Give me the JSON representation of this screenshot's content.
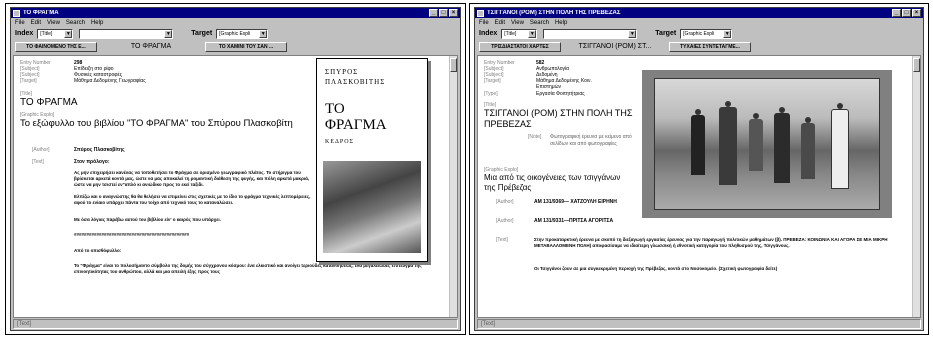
{
  "left": {
    "title": "ΤΟ ΦΡΑΓΜΑ",
    "menu": [
      "File",
      "Edit",
      "View",
      "Search",
      "Help"
    ],
    "index_label": "Index",
    "index_value": "[Title]",
    "term_value": "",
    "target_label": "Target",
    "target_value": "[Graphic Expli",
    "nav_prev": "ΤΟ ΦΑΙΝΟΜΕΝΟ ΤΗΣ Ε...",
    "nav_current": "ΤΟ ΦΡΑΓΜΑ",
    "nav_next": "ΤΟ ΧΑΜΙΝΙ ΤΟΥ ΣΑΝ ...",
    "entry_number_label": "Entry Number",
    "entry_number": "298",
    "subject1_label": "[Subject]",
    "subject1": "Επίδειξη στο ρίφο",
    "subject2_label": "[Subject]",
    "subject2": "Φυσικές καταστροφές",
    "target_field_label": "[Target]",
    "target_field": "Μάθημα Δεδομένης Γεωγραφίας",
    "title_label": "[Title]",
    "graphic_label": "[Graphic Explo]",
    "graphic_text": "Το εξώφυλλο του βιβλίου \"ΤΟ ΦΡΑΓΜΑ\" του Σπύρου Πλασκοβίτη",
    "author_label": "[Author]",
    "author": "Σπύρος Πλασκοβίτης",
    "text_label": "[Text]",
    "text_intro": "Στον πρόλογο:",
    "text_p1": "Ας μην επιχειρήσει κανένας να τοποθετήσει το Φράγμα σε ορισμένο γεωγραφικό πλάτος. Το στήριγμα του βρίσκεται αρκετά κοντά μας, ώστε να μας αποκαλεί τη ρομαντική διάθεση της φυγής, και πόλη αρκετά μακριά, ώστε να μην τσιστεί εν\"απλό κι ανιώδικο προς το εκεί ταξίδι.",
    "text_p2": "Ελπίζω και ο αναγνώστης θα θα θελήσει να επιμείνει στις σχετικές με το ίδιο το φράγμα τεχνικές λεπτομέρειες, αφού το ενίαιο υπάρχει πάντα του τοίχο από τεχνικό τους το καταναλώσει.",
    "text_p3": "Με όσα λόγιας παρέβω αυτού του βιβλίου είν' ο καιρός που υπάρχει.",
    "text_sep": "##############################################",
    "text_p4": "Από το οπισθόφυλλο:",
    "text_p5": "Το \"Φράγμα\" είναι το πολυσήμαντο σύμβολο της δομής του σύγχρονου κόσμου: ένα ελκιστικό και ανοίγει τεριούδες κατανοήσεως, ένα μεγαλειώδες επίτευγμα της επινοητικότητας του ανθρώπου, αλλά και μια απειλή έξης προς τους",
    "book_author": "ΣΠΥΡΟΣ ΠΛΑΣΚΟΒΙΤΗΣ",
    "book_title_1": "ΤΟ",
    "book_title_2": "ΦΡΑΓΜΑ",
    "book_publisher": "ΚΕΔΡΟΣ",
    "status": "[Text]"
  },
  "right": {
    "title": "ΤΣΙΓΓΑΝΟΙ (ΡΟΜ) ΣΤΗΝ ΠΟΛΗ ΤΗΣ ΠΡΕΒΕΖΑΣ",
    "menu": [
      "File",
      "Edit",
      "View",
      "Search",
      "Help"
    ],
    "index_label": "Index",
    "index_value": "[Title]",
    "term_value": "",
    "target_label": "Target",
    "target_value": "[Graphic Expli",
    "nav_prev": "ΤΡΙΣΔΙΑΣΤΑΤΟΙ ΧΑΡΤΕΣ",
    "nav_current": "ΤΣΙΓΓΑΝΟΙ (ΡΟΜ) ΣΤ...",
    "nav_next": "ΤΥΧΑΙΕΣ ΣΥΝΤΕΤΑΓΜΕ...",
    "entry_number_label": "Entry Number",
    "entry_number": "582",
    "subject1_label": "[Subject]",
    "subject1": "Ανθρωπολογία",
    "subject2_label": "[Subject]",
    "subject2": "Δεδομένη",
    "target_field_label": "[Target]",
    "target_field": "Μάθημα Δεδομένης Κοιν. Επιστημών",
    "type_label": "[Type]",
    "type": "Εργασία Φοιτητήτριας",
    "title_label": "[Title]",
    "note_label": "[Note]",
    "note": "Φωτογραφική έρευνα με κείμενο από σελίδων και από φωτογραφίες",
    "graphic_label": "[Graphic Explo]",
    "graphic_text": "Μια από τις οικογένειες των τσιγγάνων της Πρέβεζας",
    "author1_label": "[Author]",
    "author1": "ΑΜ 131/9369— ΧΑΤΖΟΥΛΗ ΕΙΡΗΝΗ",
    "author2_label": "[Author]",
    "author2": "ΑΜ 131/9331—ΠΡΙΤΣΑ ΑΓΟΡΙΤΣΑ",
    "text_label": "[Text]",
    "text_p1": "Στην προκαταρκτική έρευνα με σκοπό τη διεξαγωγή εργασίας έρευνας για την παραγωγή πολιτικών μαθημάτων (β). ΠΡΕΒΕΖΑ: ΚΟΙΝΩΝΙΑ ΚΑΙ ΑΓΟΡΑ ΣΕ ΜΙΑ ΜΙΚΡΗ ΜΕΤΑΒΑΛΛΟΜΕΝΗ ΠΟΛΗ) αποφασίσαμε να ιδιαίτερη γλωσσική ή εθνοτική κατηγορία του πληθυσμού της, Τσιγγάνους.",
    "text_p2": "Οι Τσιγγάνοι ζουν σε μια συγκεκριμένη περιοχή της Πρέβεζας, κοντά στο Νοσοκομείο. (Σχετική φωτογραφία δείτε)",
    "status": "[Text]"
  }
}
